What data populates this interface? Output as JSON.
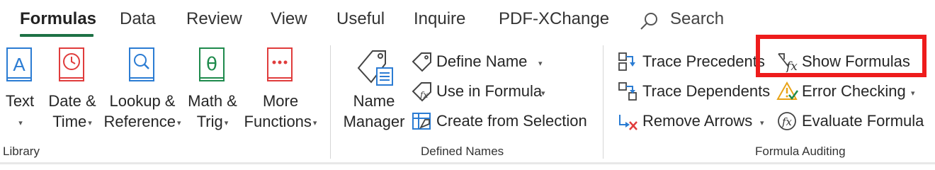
{
  "tabs": {
    "formulas": "Formulas",
    "data": "Data",
    "review": "Review",
    "view": "View",
    "useful": "Useful",
    "inquire": "Inquire",
    "pdfxchange": "PDF-XChange"
  },
  "search": {
    "label": "Search"
  },
  "library": {
    "text": {
      "line1": "Text"
    },
    "datetime": {
      "line1": "Date &",
      "line2": "Time"
    },
    "lookup": {
      "line1": "Lookup &",
      "line2": "Reference"
    },
    "math": {
      "line1": "Math &",
      "line2": "Trig"
    },
    "more": {
      "line1": "More",
      "line2": "Functions"
    },
    "group_label": "Library"
  },
  "defined_names": {
    "name_manager": {
      "line1": "Name",
      "line2": "Manager"
    },
    "define_name": "Define Name",
    "use_in_formula": "Use in Formula",
    "create_from_selection": "Create from Selection",
    "group_label": "Defined Names"
  },
  "formula_auditing": {
    "trace_precedents": "Trace Precedents",
    "trace_dependents": "Trace Dependents",
    "remove_arrows": "Remove Arrows",
    "show_formulas": "Show Formulas",
    "error_checking": "Error Checking",
    "evaluate_formula": "Evaluate Formula",
    "group_label": "Formula Auditing"
  },
  "colors": {
    "accent_green": "#1e7145",
    "highlight_red": "#ee1c1c",
    "icon_blue": "#2b7cd3",
    "icon_red": "#e03c3c",
    "icon_green": "#1e8a4c"
  }
}
